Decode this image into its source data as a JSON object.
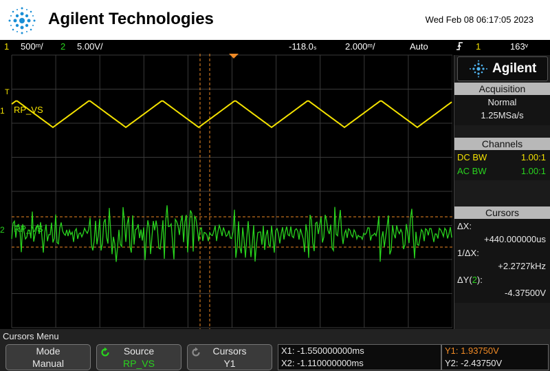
{
  "header": {
    "brand": "Agilent Technologies",
    "datetime": "Wed Feb 08 06:17:05 2023",
    "logo_icon": "agilent-spark-icon"
  },
  "statusbar": {
    "ch1_num": "1",
    "ch1_scale": "500ᵐ/",
    "ch2_num": "2",
    "ch2_scale": "5.00V/",
    "delay": "-118.0ₛ",
    "timebase": "2.000ᵐ/",
    "trigger_mode": "Auto",
    "trigger_icon": "rising-edge-icon",
    "trigger_source": "1",
    "trigger_level": "163ᵛ"
  },
  "screen": {
    "ch1_label": "RP_VS",
    "ch2_label": "RP_VS",
    "ch1_marker": "1",
    "ch2_marker": "2",
    "trigger_marker": "T",
    "colors": {
      "ch1": "#f4e200",
      "ch2": "#29d41e",
      "cursor": "#f08a25",
      "grid": "#3a3a3a"
    }
  },
  "panel": {
    "logo_text": "Agilent",
    "acquisition": {
      "title": "Acquisition",
      "mode": "Normal",
      "rate": "1.25MSa/s"
    },
    "channels": {
      "title": "Channels",
      "rows": [
        {
          "coupling": "DC BW",
          "probe": "1.00:1"
        },
        {
          "coupling": "AC BW",
          "probe": "1.00:1"
        }
      ]
    },
    "cursors": {
      "title": "Cursors",
      "dx_label": "ΔX:",
      "dx_value": "+440.000000us",
      "inv_dx_label": "1/ΔX:",
      "inv_dx_value": "+2.2727kHz",
      "dy_label_a": "ΔY(",
      "dy_label_ch": "2",
      "dy_label_b": "):",
      "dy_value": "-4.37500V"
    }
  },
  "menu": {
    "title": "Cursors Menu",
    "softkeys": [
      {
        "top": "Mode",
        "bottom": "Manual"
      },
      {
        "top": "Source",
        "bottom": "RP_VS"
      },
      {
        "top": "Cursors",
        "bottom": "Y1"
      }
    ],
    "x1": "X1: -1.550000000ms",
    "x2": "X2: -1.110000000ms",
    "y1": "Y1: 1.93750V",
    "y2": "Y2: -2.43750V"
  }
}
